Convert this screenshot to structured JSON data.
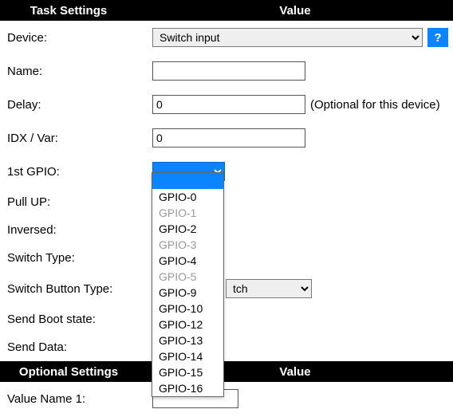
{
  "headers": {
    "task_settings": "Task Settings",
    "value": "Value",
    "optional_settings": "Optional Settings",
    "value2": "Value"
  },
  "help_label": "?",
  "rows": {
    "device": {
      "label": "Device:",
      "value": "Switch input"
    },
    "name": {
      "label": "Name:",
      "value": ""
    },
    "delay": {
      "label": "Delay:",
      "value": "0",
      "note": "(Optional for this device)"
    },
    "idx": {
      "label": "IDX / Var:",
      "value": "0"
    },
    "gpio1": {
      "label": "1st GPIO:",
      "value": ""
    },
    "pullup": {
      "label": "Pull UP:"
    },
    "inversed": {
      "label": "Inversed:"
    },
    "switch_type": {
      "label": "Switch Type:"
    },
    "switch_button_type": {
      "label": "Switch Button Type:",
      "partial": "tch"
    },
    "send_boot": {
      "label": "Send Boot state:"
    },
    "send_data": {
      "label": "Send Data:"
    },
    "value_name1": {
      "label": "Value Name 1:",
      "value": ""
    }
  },
  "gpio_options": [
    {
      "label": "",
      "highlighted": true,
      "disabled": false
    },
    {
      "label": "GPIO-0",
      "highlighted": false,
      "disabled": false
    },
    {
      "label": "GPIO-1",
      "highlighted": false,
      "disabled": true
    },
    {
      "label": "GPIO-2",
      "highlighted": false,
      "disabled": false
    },
    {
      "label": "GPIO-3",
      "highlighted": false,
      "disabled": true
    },
    {
      "label": "GPIO-4",
      "highlighted": false,
      "disabled": false
    },
    {
      "label": "GPIO-5",
      "highlighted": false,
      "disabled": true
    },
    {
      "label": "GPIO-9",
      "highlighted": false,
      "disabled": false
    },
    {
      "label": "GPIO-10",
      "highlighted": false,
      "disabled": false
    },
    {
      "label": "GPIO-12",
      "highlighted": false,
      "disabled": false
    },
    {
      "label": "GPIO-13",
      "highlighted": false,
      "disabled": false
    },
    {
      "label": "GPIO-14",
      "highlighted": false,
      "disabled": false
    },
    {
      "label": "GPIO-15",
      "highlighted": false,
      "disabled": false
    },
    {
      "label": "GPIO-16",
      "highlighted": false,
      "disabled": false
    }
  ]
}
